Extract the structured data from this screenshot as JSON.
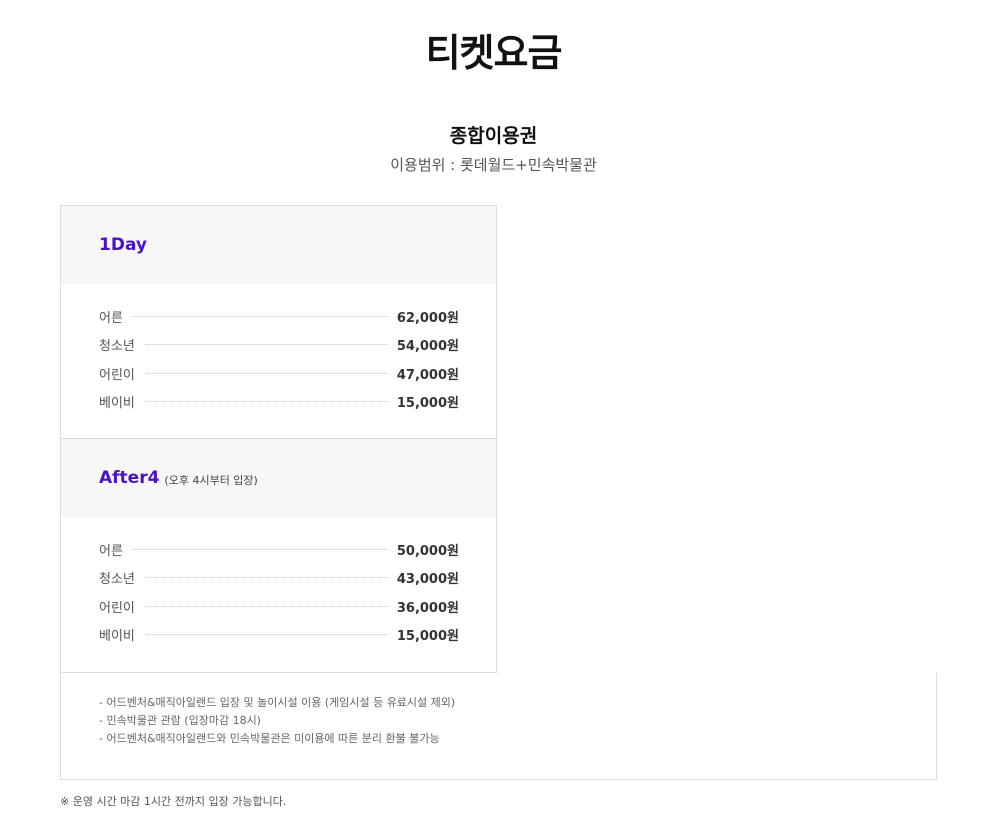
{
  "page": {
    "title": "티켓요금"
  },
  "pass": {
    "name": "종합이용권",
    "scope": "이용범위 : 롯데월드+민속박물관"
  },
  "cards": [
    {
      "name": "1Day",
      "note": "",
      "rows": [
        {
          "label": "어른",
          "price": "62,000원"
        },
        {
          "label": "청소년",
          "price": "54,000원"
        },
        {
          "label": "어린이",
          "price": "47,000원"
        },
        {
          "label": "베이비",
          "price": "15,000원"
        }
      ]
    },
    {
      "name": "After4",
      "note": "(오후 4시부터 입장)",
      "rows": [
        {
          "label": "어른",
          "price": "50,000원"
        },
        {
          "label": "청소년",
          "price": "43,000원"
        },
        {
          "label": "어린이",
          "price": "36,000원"
        },
        {
          "label": "베이비",
          "price": "15,000원"
        }
      ]
    }
  ],
  "notes": [
    "- 어드벤처&매직아일랜드 입장 및 놀이시설 이용 (게임시설 등 유료시설 제외)",
    "- 민속박물관 관람 (입장마감 18시)",
    "- 어드벤처&매직아일랜드와 민속박물관은 미이용에 따른 분리 환불 불가능"
  ],
  "footer": {
    "note": "※ 운영 시간 마감 1시간 전까지 입장 가능합니다."
  }
}
